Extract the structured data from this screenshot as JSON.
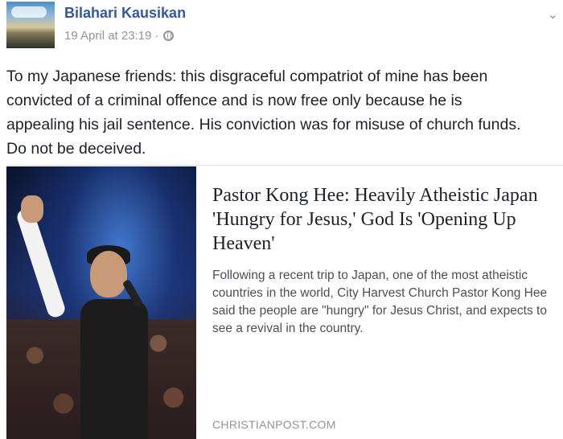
{
  "post": {
    "author": "Bilahari Kausikan",
    "timestamp": "19 April at 23:19",
    "separator": "·",
    "audience_icon": "globe-icon",
    "menu_icon": "chevron-down-icon",
    "text_lines": [
      "To my Japanese friends: this disgraceful compatriot of mine has been",
      "convicted of a criminal offence and is now free only because he is",
      "appealing his jail sentence. His conviction was for misuse of church funds.",
      "Do not be deceived."
    ]
  },
  "link_card": {
    "title": "Pastor Kong Hee: Heavily Atheistic Japan 'Hungry for Jesus,' God Is 'Opening Up Heaven'",
    "description": "Following a recent trip to Japan, one of the most atheistic countries in the world, City Harvest Church Pastor Kong Hee said the people are \"hungry\" for Jesus Christ, and expects to see a revival in the country.",
    "source": "CHRISTIANPOST.COM"
  },
  "colors": {
    "author": "#365899",
    "meta": "#90949c",
    "text": "#1d2129",
    "description": "#4b4f56"
  }
}
